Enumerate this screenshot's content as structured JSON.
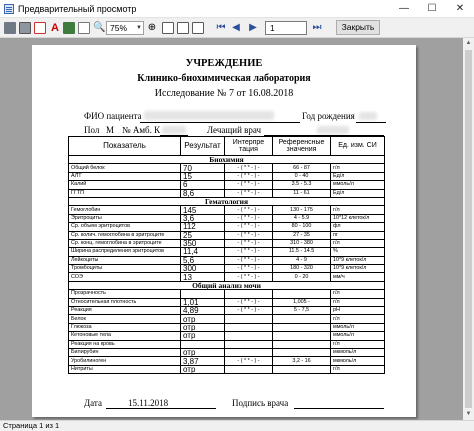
{
  "window": {
    "title": "Предварительный просмотр"
  },
  "toolbar": {
    "zoom": "75%",
    "page_value": "1",
    "close_label": "Закрыть",
    "icons": [
      "printer-icon",
      "setup-icon",
      "acrobat-icon",
      "html-icon",
      "export-icon",
      "copy-icon",
      "search-icon",
      "zoom-icon"
    ],
    "nav_icons": [
      "first-page-icon",
      "prev-page-icon",
      "next-page-icon",
      "last-page-icon"
    ]
  },
  "document": {
    "title1": "УЧРЕЖДЕНИЕ",
    "title2": "Клинико-биохимическая лаборатория",
    "title3": "Исследование № 7 от 16.08.2018",
    "patient_label": "ФИО пациента",
    "birth_label": "Год рождения",
    "sex_label": "Пол",
    "sex_value": "М",
    "card_label": "№ Амб. К",
    "doctor_label": "Лечащий врач",
    "columns": [
      "Показатель",
      "Результат",
      "Интерпре тация",
      "Референсные значения",
      "Ед. изм. СИ"
    ],
    "sections": [
      {
        "name": "Биохимия",
        "rows": [
          [
            "Общий белок",
            "70",
            "- ( * * - ) -",
            "66 - 87",
            "г/л"
          ],
          [
            "АЛТ",
            "15",
            "- ( * * - ) -",
            "0 - 40",
            "Ед/л"
          ],
          [
            "Калий",
            "6",
            "- ( * * - ) -",
            "3.5 - 5.3",
            "ммоль/л"
          ],
          [
            "ГГТП",
            "8,6",
            "- ( * * - ) -",
            "11 - 61",
            "Ед/л"
          ]
        ]
      },
      {
        "name": "Гематология",
        "rows": [
          [
            "Гемоглобин",
            "145",
            "- ( * * - ) -",
            "130 - 175",
            "г/л"
          ],
          [
            "Эритроциты",
            "3,6",
            "- ( * * - ) -",
            "4 - 5.9",
            "10*12 клеток/л"
          ],
          [
            "Ср. объем эритроцитов",
            "112",
            "- ( * * - ) -",
            "80 - 100",
            "фл"
          ],
          [
            "Ср. колич. гемоглобина в эритроците",
            "25",
            "- ( * * - ) -",
            "27 - 35",
            "пг"
          ],
          [
            "Ср. конц. гемоглобина в эритроците",
            "350",
            "- ( * * - ) -",
            "310 - 380",
            "г/л"
          ],
          [
            "Ширина распределения эритроцитов",
            "11,4",
            "- ( * * - ) -",
            "11.5 - 14.5",
            "%"
          ],
          [
            "Лейкоциты",
            "5,6",
            "- ( * * - ) -",
            "4 - 9",
            "10*9 клеток/л"
          ],
          [
            "Тромбоциты",
            "300",
            "- ( * * - ) -",
            "180 - 320",
            "10*9 клеток/л"
          ],
          [
            "СОЭ",
            "13",
            "- ( * * - ) -",
            "0 - 20",
            "мм/ч"
          ]
        ]
      },
      {
        "name": "Общий анализ мочи",
        "rows": [
          [
            "Прозрачность",
            "",
            "",
            "",
            "г/л"
          ],
          [
            "Относительная плотность",
            "1,01",
            "- ( * * - ) -",
            "1,005 -",
            "г/л"
          ],
          [
            "Реакция",
            "4,89",
            "- ( * * - ) -",
            "5 - 7,5",
            "pH"
          ],
          [
            "Белок",
            "отр",
            "",
            "",
            "г/л"
          ],
          [
            "Глюкоза",
            "отр",
            "",
            "",
            "ммоль/л"
          ],
          [
            "Кетоновые тела",
            "отр",
            "",
            "",
            "ммоль/л"
          ],
          [
            "Реакция на кровь",
            "",
            "",
            "",
            "г/л"
          ],
          [
            "Билирубин",
            "отр",
            "",
            "",
            "мкмоль/л"
          ],
          [
            "Уробилиноген",
            "3,87",
            "- ( * * - ) -",
            "3,2 - 16",
            "мкмоль/л"
          ],
          [
            "Нитриты",
            "отр",
            "",
            "",
            "г/л"
          ]
        ]
      }
    ],
    "date_label": "Дата",
    "date_value": "15.11.2018",
    "signature_label": "Подпись врача"
  },
  "status": {
    "text": "Страница 1 из 1"
  }
}
